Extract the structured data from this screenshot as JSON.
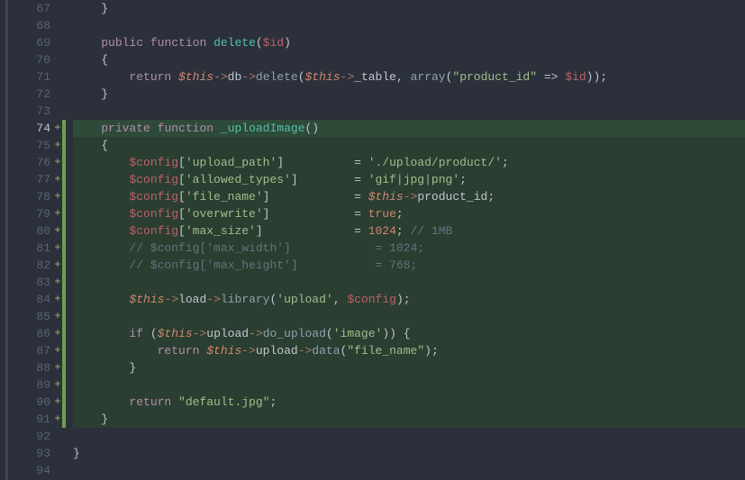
{
  "lines": [
    {
      "num": 67,
      "mod": "",
      "fold": "",
      "hl": "",
      "tokens": [
        {
          "t": "    }",
          "c": "punct"
        }
      ]
    },
    {
      "num": 68,
      "mod": "",
      "fold": "",
      "hl": "",
      "tokens": []
    },
    {
      "num": 69,
      "mod": "",
      "fold": "",
      "hl": "",
      "tokens": [
        {
          "t": "    ",
          "c": ""
        },
        {
          "t": "public",
          "c": "kw"
        },
        {
          "t": " ",
          "c": ""
        },
        {
          "t": "function",
          "c": "kw"
        },
        {
          "t": " ",
          "c": ""
        },
        {
          "t": "delete",
          "c": "fname"
        },
        {
          "t": "(",
          "c": "punct"
        },
        {
          "t": "$id",
          "c": "redvar"
        },
        {
          "t": ")",
          "c": "punct"
        }
      ]
    },
    {
      "num": 70,
      "mod": "",
      "fold": "",
      "hl": "",
      "tokens": [
        {
          "t": "    {",
          "c": "punct"
        }
      ]
    },
    {
      "num": 71,
      "mod": "",
      "fold": "",
      "hl": "",
      "tokens": [
        {
          "t": "        ",
          "c": ""
        },
        {
          "t": "return",
          "c": "kw"
        },
        {
          "t": " ",
          "c": ""
        },
        {
          "t": "$this",
          "c": "var"
        },
        {
          "t": "->",
          "c": "arrow"
        },
        {
          "t": "db",
          "c": "ident"
        },
        {
          "t": "->",
          "c": "arrow"
        },
        {
          "t": "delete",
          "c": "method"
        },
        {
          "t": "(",
          "c": "punct"
        },
        {
          "t": "$this",
          "c": "var"
        },
        {
          "t": "->",
          "c": "arrow"
        },
        {
          "t": "_table",
          "c": "ident"
        },
        {
          "t": ", ",
          "c": "punct"
        },
        {
          "t": "array",
          "c": "method"
        },
        {
          "t": "(",
          "c": "punct"
        },
        {
          "t": "\"product_id\"",
          "c": "str"
        },
        {
          "t": " => ",
          "c": "op"
        },
        {
          "t": "$id",
          "c": "redvar"
        },
        {
          "t": "));",
          "c": "punct"
        }
      ]
    },
    {
      "num": 72,
      "mod": "",
      "fold": "",
      "hl": "",
      "tokens": [
        {
          "t": "    }",
          "c": "punct"
        }
      ]
    },
    {
      "num": 73,
      "mod": "",
      "fold": "",
      "hl": "",
      "tokens": []
    },
    {
      "num": 74,
      "mod": "+",
      "fold": "green",
      "hl": "hl-line",
      "current": true,
      "tokens": [
        {
          "t": "    ",
          "c": ""
        },
        {
          "t": "private",
          "c": "kw"
        },
        {
          "t": " ",
          "c": ""
        },
        {
          "t": "function",
          "c": "kw"
        },
        {
          "t": " ",
          "c": ""
        },
        {
          "t": "_uploadImage",
          "c": "fname"
        },
        {
          "t": "()",
          "c": "punct"
        }
      ]
    },
    {
      "num": 75,
      "mod": "+",
      "fold": "green",
      "hl": "hl-block",
      "tokens": [
        {
          "t": "    {",
          "c": "punct"
        }
      ]
    },
    {
      "num": 76,
      "mod": "+",
      "fold": "green",
      "hl": "hl-block",
      "tokens": [
        {
          "t": "        ",
          "c": ""
        },
        {
          "t": "$config",
          "c": "redvar"
        },
        {
          "t": "[",
          "c": "punct"
        },
        {
          "t": "'upload_path'",
          "c": "str"
        },
        {
          "t": "]",
          "c": "punct"
        },
        {
          "t": "          = ",
          "c": "op"
        },
        {
          "t": "'./upload/product/'",
          "c": "str"
        },
        {
          "t": ";",
          "c": "punct"
        }
      ]
    },
    {
      "num": 77,
      "mod": "+",
      "fold": "green",
      "hl": "hl-block",
      "tokens": [
        {
          "t": "        ",
          "c": ""
        },
        {
          "t": "$config",
          "c": "redvar"
        },
        {
          "t": "[",
          "c": "punct"
        },
        {
          "t": "'allowed_types'",
          "c": "str"
        },
        {
          "t": "]",
          "c": "punct"
        },
        {
          "t": "        = ",
          "c": "op"
        },
        {
          "t": "'gif|jpg|png'",
          "c": "str"
        },
        {
          "t": ";",
          "c": "punct"
        }
      ]
    },
    {
      "num": 78,
      "mod": "+",
      "fold": "green",
      "hl": "hl-block",
      "tokens": [
        {
          "t": "        ",
          "c": ""
        },
        {
          "t": "$config",
          "c": "redvar"
        },
        {
          "t": "[",
          "c": "punct"
        },
        {
          "t": "'file_name'",
          "c": "str"
        },
        {
          "t": "]",
          "c": "punct"
        },
        {
          "t": "            = ",
          "c": "op"
        },
        {
          "t": "$this",
          "c": "var"
        },
        {
          "t": "->",
          "c": "arrow"
        },
        {
          "t": "product_id",
          "c": "ident"
        },
        {
          "t": ";",
          "c": "punct"
        }
      ]
    },
    {
      "num": 79,
      "mod": "+",
      "fold": "green",
      "hl": "hl-block",
      "tokens": [
        {
          "t": "        ",
          "c": ""
        },
        {
          "t": "$config",
          "c": "redvar"
        },
        {
          "t": "[",
          "c": "punct"
        },
        {
          "t": "'overwrite'",
          "c": "str"
        },
        {
          "t": "]",
          "c": "punct"
        },
        {
          "t": "            = ",
          "c": "op"
        },
        {
          "t": "true",
          "c": "bool"
        },
        {
          "t": ";",
          "c": "punct"
        }
      ]
    },
    {
      "num": 80,
      "mod": "+",
      "fold": "green",
      "hl": "hl-block",
      "tokens": [
        {
          "t": "        ",
          "c": ""
        },
        {
          "t": "$config",
          "c": "redvar"
        },
        {
          "t": "[",
          "c": "punct"
        },
        {
          "t": "'max_size'",
          "c": "str"
        },
        {
          "t": "]",
          "c": "punct"
        },
        {
          "t": "             = ",
          "c": "op"
        },
        {
          "t": "1024",
          "c": "num"
        },
        {
          "t": "; ",
          "c": "punct"
        },
        {
          "t": "// 1MB",
          "c": "comment"
        }
      ]
    },
    {
      "num": 81,
      "mod": "+",
      "fold": "green",
      "hl": "hl-block",
      "tokens": [
        {
          "t": "        ",
          "c": ""
        },
        {
          "t": "// $config['max_width']            = 1024;",
          "c": "comment"
        }
      ]
    },
    {
      "num": 82,
      "mod": "+",
      "fold": "green",
      "hl": "hl-block",
      "tokens": [
        {
          "t": "        ",
          "c": ""
        },
        {
          "t": "// $config['max_height']           = 768;",
          "c": "comment"
        }
      ]
    },
    {
      "num": 83,
      "mod": "+",
      "fold": "green",
      "hl": "hl-block",
      "tokens": []
    },
    {
      "num": 84,
      "mod": "+",
      "fold": "green",
      "hl": "hl-block",
      "tokens": [
        {
          "t": "        ",
          "c": ""
        },
        {
          "t": "$this",
          "c": "var"
        },
        {
          "t": "->",
          "c": "arrow"
        },
        {
          "t": "load",
          "c": "ident"
        },
        {
          "t": "->",
          "c": "arrow"
        },
        {
          "t": "library",
          "c": "method"
        },
        {
          "t": "(",
          "c": "punct"
        },
        {
          "t": "'upload'",
          "c": "str"
        },
        {
          "t": ", ",
          "c": "punct"
        },
        {
          "t": "$config",
          "c": "redvar"
        },
        {
          "t": ");",
          "c": "punct"
        }
      ]
    },
    {
      "num": 85,
      "mod": "+",
      "fold": "green",
      "hl": "hl-block",
      "tokens": []
    },
    {
      "num": 86,
      "mod": "+",
      "fold": "green",
      "hl": "hl-block",
      "tokens": [
        {
          "t": "        ",
          "c": ""
        },
        {
          "t": "if",
          "c": "kw"
        },
        {
          "t": " (",
          "c": "punct"
        },
        {
          "t": "$this",
          "c": "var"
        },
        {
          "t": "->",
          "c": "arrow"
        },
        {
          "t": "upload",
          "c": "ident"
        },
        {
          "t": "->",
          "c": "arrow"
        },
        {
          "t": "do_upload",
          "c": "method"
        },
        {
          "t": "(",
          "c": "punct"
        },
        {
          "t": "'image'",
          "c": "str"
        },
        {
          "t": ")) {",
          "c": "punct"
        }
      ]
    },
    {
      "num": 87,
      "mod": "+",
      "fold": "green",
      "hl": "hl-block",
      "tokens": [
        {
          "t": "            ",
          "c": ""
        },
        {
          "t": "return",
          "c": "kw"
        },
        {
          "t": " ",
          "c": ""
        },
        {
          "t": "$this",
          "c": "var"
        },
        {
          "t": "->",
          "c": "arrow"
        },
        {
          "t": "upload",
          "c": "ident"
        },
        {
          "t": "->",
          "c": "arrow"
        },
        {
          "t": "data",
          "c": "method"
        },
        {
          "t": "(",
          "c": "punct"
        },
        {
          "t": "\"file_name\"",
          "c": "str"
        },
        {
          "t": ");",
          "c": "punct"
        }
      ]
    },
    {
      "num": 88,
      "mod": "+",
      "fold": "green",
      "hl": "hl-block",
      "tokens": [
        {
          "t": "        }",
          "c": "punct"
        }
      ]
    },
    {
      "num": 89,
      "mod": "+",
      "fold": "green",
      "hl": "hl-block",
      "tokens": [
        {
          "t": "        ",
          "c": ""
        }
      ]
    },
    {
      "num": 90,
      "mod": "+",
      "fold": "green",
      "hl": "hl-block",
      "tokens": [
        {
          "t": "        ",
          "c": ""
        },
        {
          "t": "return",
          "c": "kw"
        },
        {
          "t": " ",
          "c": ""
        },
        {
          "t": "\"default.jpg\"",
          "c": "str"
        },
        {
          "t": ";",
          "c": "punct"
        }
      ]
    },
    {
      "num": 91,
      "mod": "+",
      "fold": "green",
      "hl": "hl-block",
      "tokens": [
        {
          "t": "    }",
          "c": "punct"
        }
      ]
    },
    {
      "num": 92,
      "mod": "",
      "fold": "",
      "hl": "",
      "tokens": []
    },
    {
      "num": 93,
      "mod": "",
      "fold": "",
      "hl": "",
      "tokens": [
        {
          "t": "}",
          "c": "punct"
        }
      ]
    },
    {
      "num": 94,
      "mod": "",
      "fold": "",
      "hl": "",
      "tokens": []
    }
  ]
}
